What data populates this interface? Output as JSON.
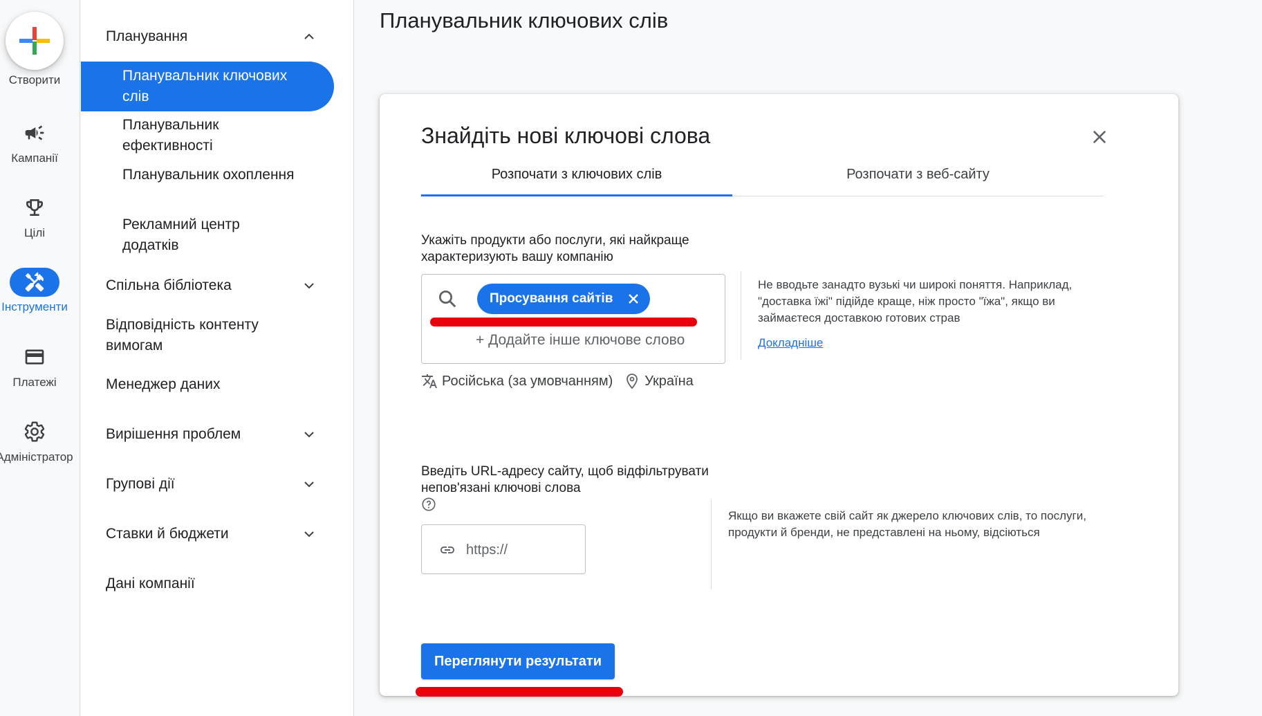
{
  "rail": {
    "create_label": "Створити",
    "items": [
      {
        "label": "Кампанії",
        "icon": "megaphone-icon"
      },
      {
        "label": "Цілі",
        "icon": "trophy-icon"
      },
      {
        "label": "Інструменти",
        "icon": "tools-icon",
        "active": true
      },
      {
        "label": "Платежі",
        "icon": "credit-card-icon"
      },
      {
        "label": "Адміністратор",
        "icon": "gear-icon"
      }
    ]
  },
  "sidebar": {
    "planning": "Планування",
    "sub_items": [
      "Планувальник ключових слів",
      "Планувальник ефективності",
      "Планувальник охоплення",
      "Рекламний центр додатків"
    ],
    "items": [
      "Спільна бібліотека",
      "Відповідність контенту вимогам",
      "Менеджер даних",
      "Вирішення проблем",
      "Групові дії",
      "Ставки й бюджети",
      "Дані компанії"
    ]
  },
  "page": {
    "title": "Планувальник ключових слів"
  },
  "dialog": {
    "title": "Знайдіть нові ключові слова",
    "tabs": [
      "Розпочати з ключових слів",
      "Розпочати з веб-сайту"
    ],
    "keywords_prompt": "Укажіть продукти або послуги, які найкраще характеризують вашу компанію",
    "chip": "Просування сайтів",
    "add_keyword": "+ Додайте інше ключове слово",
    "hint1": "Не вводьте занадто вузькі чи широкі поняття. Наприклад, \"доставка їжі\" підійде краще, ніж просто \"їжа\", якщо ви займаєтеся доставкою готових страв",
    "more_link": "Докладніше",
    "language": "Російська (за умовчанням)",
    "location": "Україна",
    "url_prompt": "Введіть URL-адресу сайту, щоб відфільтрувати непов'язані ключові слова",
    "url_placeholder": "https://",
    "hint2": "Якщо ви вкажете свій сайт як джерело ключових слів, то послуги, продукти й бренди, не представлені на ньому, відсіються",
    "submit": "Переглянути результати"
  },
  "colors": {
    "accent": "#1a73e8",
    "highlight": "#e8000b"
  }
}
